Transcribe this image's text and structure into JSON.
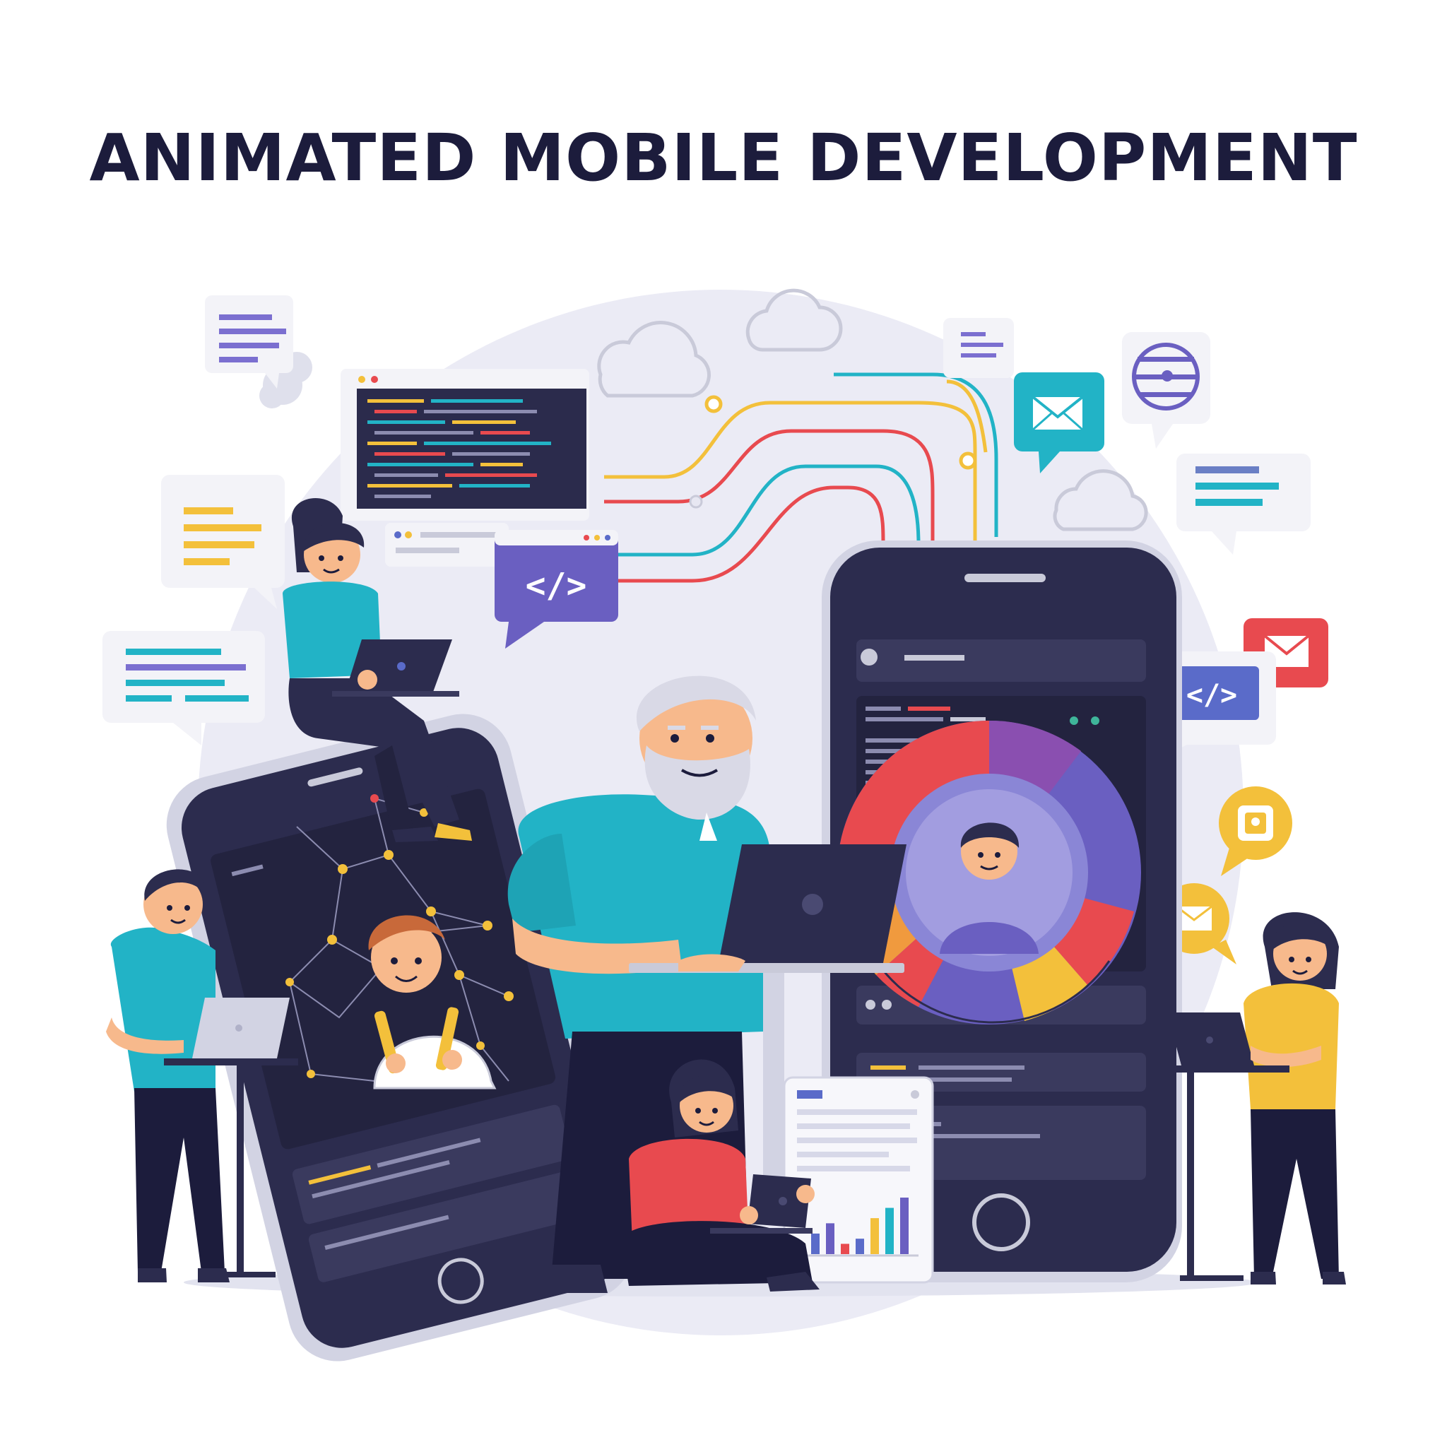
{
  "title": "ANIMATED MOBILE DEVELOPMENT",
  "code_tag": "</>",
  "colors": {
    "background": "#ffffff",
    "backdrop_circle": "#ebebf5",
    "phone_body": "#2c2c4e",
    "phone_frame": "#d2d3e3",
    "title_text": "#1c1c3c",
    "teal": "#22b3c6",
    "red": "#e84a4f",
    "yellow": "#f3c03b",
    "purple": "#6a5fc1",
    "blue": "#5a6bc9"
  },
  "icons": [
    "code-window-icon",
    "code-tag-bubble-icon",
    "mail-bubble-icon",
    "globe-bubble-icon",
    "cloud-icon",
    "text-lines-bubble-icon",
    "lock-bubble-icon",
    "bar-chart-icon",
    "network-graph-icon",
    "donut-chart-icon"
  ],
  "bar_chart": {
    "type": "bar",
    "values": [
      4,
      6,
      2,
      3,
      7,
      9,
      11
    ]
  }
}
